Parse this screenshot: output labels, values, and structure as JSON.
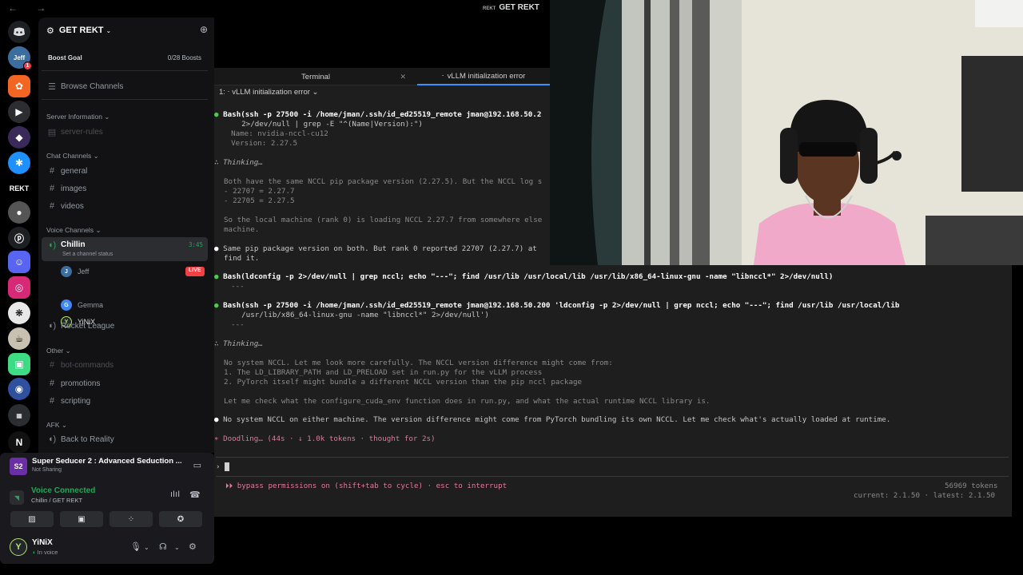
{
  "topbar": {
    "nav_arrows": "← →",
    "title_prefix": "REKT",
    "title": "GET REKT"
  },
  "servers": [
    {
      "name": "discord-icon",
      "label": ""
    },
    {
      "name": "jeff-avatar",
      "label": "Jeff",
      "badge": "1"
    },
    {
      "name": "orange-server-icon",
      "label": ""
    },
    {
      "name": "play-server-icon",
      "label": ""
    },
    {
      "name": "purple-server-icon",
      "label": ""
    },
    {
      "name": "blue-star-server-icon",
      "label": ""
    },
    {
      "name": "rekt-server-icon",
      "label": "REKT"
    },
    {
      "name": "dark-avatar-server-icon",
      "label": ""
    },
    {
      "name": "patreon-server-icon",
      "label": ""
    },
    {
      "name": "robot-server-icon",
      "label": ""
    },
    {
      "name": "instagram-server-icon",
      "label": ""
    },
    {
      "name": "openai-server-icon",
      "label": ""
    },
    {
      "name": "cup-server-icon",
      "label": ""
    },
    {
      "name": "android-server-icon",
      "label": ""
    },
    {
      "name": "globe-server-icon",
      "label": ""
    },
    {
      "name": "folder-server-icon",
      "label": ""
    },
    {
      "name": "logo-server-icon",
      "label": ""
    }
  ],
  "guild": {
    "name": "GET REKT",
    "boost_label": "Boost Goal",
    "boost_count": "0/28 Boosts",
    "browse": "Browse Channels"
  },
  "categories": {
    "server_info": "Server Information",
    "chat": "Chat Channels",
    "voice": "Voice Channels",
    "other": "Other",
    "afk": "AFK"
  },
  "channels": {
    "server_rules": "server-rules",
    "general": "general",
    "images": "images",
    "videos": "videos",
    "chillin": "Chillin",
    "chillin_status": "Set a channel status",
    "chillin_time": "3:45",
    "rocket_league": "Rocket League",
    "bot_commands": "bot-commands",
    "promotions": "promotions",
    "scripting": "scripting",
    "back_to_reality": "Back to Reality"
  },
  "voice_users": [
    {
      "name": "Jeff",
      "live": "LIVE"
    },
    {
      "name": "Gemma"
    },
    {
      "name": "YiNiX"
    }
  ],
  "activity": {
    "title": "Super Seducer 2 : Advanced Seduction ...",
    "sub": "Not Sharing"
  },
  "voice_panel": {
    "status": "Voice Connected",
    "location": "Chillin / GET REKT"
  },
  "user_panel": {
    "name": "YiNiX",
    "status": "In voice"
  },
  "terminal": {
    "tab1": "Terminal",
    "tab2": "vLLM initialization error",
    "subheader": "1:  ⋅ vLLM initialization error ⌄",
    "lines": {
      "l1": "Bash(ssh -p 27500 -i /home/jman/.ssh/id_ed25519_remote jman@192.168.50.2",
      "l2": "    2>/dev/null | grep -E \"^(Name|Version):\")",
      "l3": "  Name: nvidia-nccl-cu12",
      "l4": "  Version: 2.27.5",
      "thinking1": "Thinking…",
      "t1": "Both have the same NCCL pip package version (2.27.5). But the NCCL log s",
      "t2": "- 22707 = 2.27.7",
      "t3": "- 22705 = 2.27.5",
      "t4": "So the local machine (rank 0) is loading NCCL 2.27.7 from somewhere else",
      "t5": "machine.",
      "m1": "Same pip package version on both. But rank 0 reported 22707 (2.27.7) at",
      "m2": "find it.",
      "b2": "Bash(ldconfig -p 2>/dev/null | grep nccl; echo \"---\"; find /usr/lib /usr/local/lib /usr/lib/x86_64-linux-gnu -name \"libnccl*\" 2>/dev/null)",
      "b2r": "  ---",
      "b3": "Bash(ssh -p 27500 -i /home/jman/.ssh/id_ed25519_remote jman@192.168.50.200 'ldconfig -p 2>/dev/null | grep nccl; echo \"---\"; find /usr/lib /usr/local/lib",
      "b3b": "    /usr/lib/x86_64-linux-gnu -name \"libnccl*\" 2>/dev/null')",
      "b3r": "  ---",
      "thinking2": "Thinking…",
      "n1": "No system NCCL. Let me look more carefully. The NCCL version difference might come from:",
      "n2": "1. The LD_LIBRARY_PATH and LD_PRELOAD set in run.py for the vLLM process",
      "n3": "2. PyTorch itself might bundle a different NCCL version than the pip nccl package",
      "n4": "Let me check what the configure_cuda_env function does in run.py, and what the actual runtime NCCL library is.",
      "final": "No system NCCL on either machine. The version difference might come from PyTorch bundling its own NCCL. Let me check what's actually loaded at runtime.",
      "doodling": "Doodling… (44s · ↓ 1.0k tokens · thought for 2s)",
      "prompt": "›",
      "perm": "⏵⏵ bypass permissions on (shift+tab to cycle) · esc to interrupt",
      "tokens": "56969 tokens",
      "version": "current: 2.1.50 · latest: 2.1.50"
    }
  },
  "colors": {
    "accent": "#3794ff",
    "green": "#23a55a",
    "live_red": "#f23f43"
  }
}
